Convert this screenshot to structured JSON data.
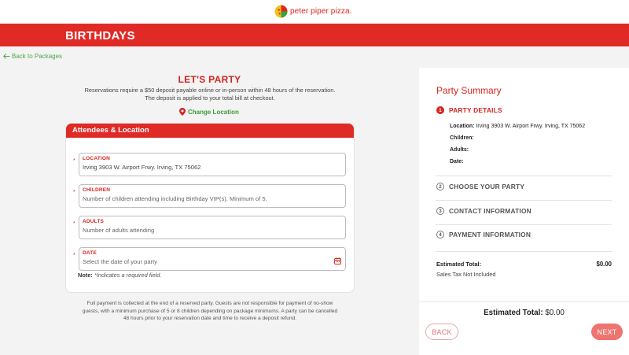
{
  "brand": {
    "logo_text": "peter piper pizza.",
    "accent_color": "#df2a26",
    "link_color": "#4ea64a"
  },
  "header": {
    "title": "BIRTHDAYS"
  },
  "nav": {
    "back_label": "Back to Packages",
    "back_icon": "arrow-left-icon"
  },
  "main": {
    "title": "LET'S PARTY",
    "intro_line1": "Reservations require a $50 deposit payable online or in-person within 48 hours of the reservation.",
    "intro_line2": "The deposit is applied to your total bill at checkout.",
    "change_location_label": "Change Location",
    "change_location_icon": "map-pin-icon"
  },
  "form": {
    "section_title": "Attendees & Location",
    "required_marker": "*",
    "fields": [
      {
        "label": "LOCATION",
        "value": "Irving 3903 W. Airport Frwy. Irving, TX 75062",
        "placeholder": ""
      },
      {
        "label": "CHILDREN",
        "value": "",
        "placeholder": "Number of children attending including Birthday VIP(s). Minimum of 5."
      },
      {
        "label": "ADULTS",
        "value": "",
        "placeholder": "Number of adults attending"
      },
      {
        "label": "DATE",
        "value": "",
        "placeholder": "Select the date of your party",
        "icon": "calendar-icon"
      }
    ],
    "note_label": "Note:",
    "note_text": "*Indicates a required field."
  },
  "footer_note": {
    "line1": "Full payment is collected at the end of a reserved party. Guests are not responsible for payment of no-show",
    "line2": "guests, with a minimum purchase of 5 or 8 children depending on package minimums. A party can be cancelled",
    "line3": "48 hours prior to your reservation date and time to receive a deposit refund."
  },
  "summary": {
    "title": "Party Summary",
    "steps": [
      {
        "number": "1",
        "label": "PARTY DETAILS",
        "active": true
      },
      {
        "number": "2",
        "label": "CHOOSE YOUR PARTY",
        "active": false
      },
      {
        "number": "3",
        "label": "CONTACT INFORMATION",
        "active": false
      },
      {
        "number": "4",
        "label": "PAYMENT INFORMATION",
        "active": false
      }
    ],
    "details": {
      "location_label": "Location:",
      "location_value": "Irving 3903 W. Airport Frwy. Irving, TX 75062",
      "children_label": "Children:",
      "adults_label": "Adults:",
      "date_label": "Date:"
    },
    "estimated_total_label": "Estimated Total:",
    "estimated_total_value": "$0.00",
    "tax_note": "Sales Tax Not Included"
  },
  "bottom": {
    "total_label": "Estimated Total:",
    "total_value": "$0.00",
    "back_label": "BACK",
    "next_label": "NEXT"
  }
}
